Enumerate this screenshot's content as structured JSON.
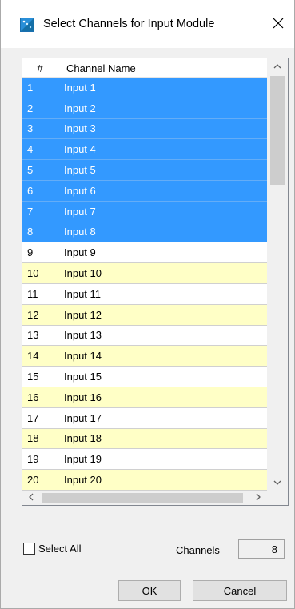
{
  "window": {
    "title": "Select Channels for  Input Module",
    "close_label": "✕"
  },
  "list": {
    "columns": [
      "#",
      "Channel Name"
    ],
    "rows": [
      {
        "num": "1",
        "name": "Input 1",
        "selected": true
      },
      {
        "num": "2",
        "name": "Input 2",
        "selected": true
      },
      {
        "num": "3",
        "name": "Input 3",
        "selected": true
      },
      {
        "num": "4",
        "name": "Input 4",
        "selected": true
      },
      {
        "num": "5",
        "name": "Input 5",
        "selected": true
      },
      {
        "num": "6",
        "name": "Input 6",
        "selected": true
      },
      {
        "num": "7",
        "name": "Input 7",
        "selected": true
      },
      {
        "num": "8",
        "name": "Input 8",
        "selected": true
      },
      {
        "num": "9",
        "name": "Input 9",
        "selected": false
      },
      {
        "num": "10",
        "name": "Input 10",
        "selected": false
      },
      {
        "num": "11",
        "name": "Input 11",
        "selected": false
      },
      {
        "num": "12",
        "name": "Input 12",
        "selected": false
      },
      {
        "num": "13",
        "name": "Input 13",
        "selected": false
      },
      {
        "num": "14",
        "name": "Input 14",
        "selected": false
      },
      {
        "num": "15",
        "name": "Input 15",
        "selected": false
      },
      {
        "num": "16",
        "name": "Input 16",
        "selected": false
      },
      {
        "num": "17",
        "name": "Input 17",
        "selected": false
      },
      {
        "num": "18",
        "name": "Input 18",
        "selected": false
      },
      {
        "num": "19",
        "name": "Input 19",
        "selected": false
      },
      {
        "num": "20",
        "name": "Input 20",
        "selected": false
      }
    ]
  },
  "footer": {
    "select_all_label": "Select All",
    "select_all_checked": false,
    "channels_label": "Channels",
    "channels_value": "8",
    "ok_label": "OK",
    "cancel_label": "Cancel"
  },
  "colors": {
    "selection": "#3399ff",
    "alt_row": "#ffffc6",
    "plain_row": "#ffffff"
  },
  "icons": {
    "app": "app-icon",
    "close": "close-icon",
    "scroll_up": "chevron-up-icon",
    "scroll_down": "chevron-down-icon",
    "scroll_left": "chevron-left-icon",
    "scroll_right": "chevron-right-icon"
  }
}
